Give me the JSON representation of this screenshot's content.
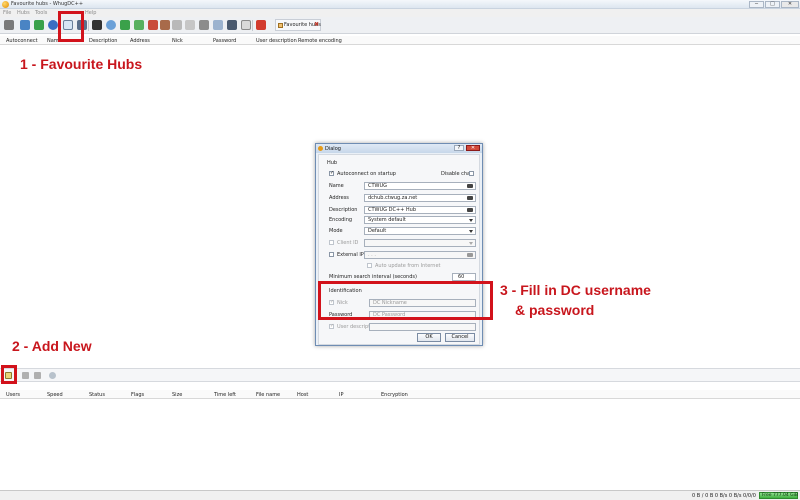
{
  "window": {
    "title": "Favourite hubs - WhugDC++",
    "minimize_label": "─",
    "maximize_label": "□",
    "close_label": "✕"
  },
  "menu": [
    "File",
    "Hubs",
    "Tools",
    "",
    "Help"
  ],
  "toolbar": {
    "active_tab": "Favourite hubs",
    "tab_close": "✖"
  },
  "favorite_hubs": {
    "columns": [
      "Autoconnect",
      "Name",
      "Description",
      "Address",
      "Nick",
      "Password",
      "User description",
      "Remote encoding"
    ]
  },
  "annotations": {
    "favourite_hubs": "1 - Favourite Hubs",
    "add_new": "2 - Add New",
    "fill_in_line1": "3 - Fill in DC username",
    "fill_in_line2": "& password"
  },
  "dialog": {
    "title": "Dialog",
    "help": "?",
    "close": "✕",
    "section_hub": "Hub",
    "autoconnect_label": "Autoconnect on startup",
    "autoconnect_checked": true,
    "disable_chat_label": "Disable chat",
    "name_label": "Name",
    "name_value": "CTWUG",
    "address_label": "Address",
    "address_value": "dchub.ctwug.za.net",
    "description_label": "Description",
    "description_value": "CTWUG DC++ Hub",
    "encoding_label": "Encoding",
    "encoding_value": "System default",
    "mode_label": "Mode",
    "mode_value": "Default",
    "client_id_label": "Client ID",
    "external_ip_label": "External IP",
    "external_ip_value": ". . .",
    "auto_update_label": "Auto update from Internet",
    "min_search_label": "Minimum search interval (seconds)",
    "min_search_value": "60",
    "identification_label": "Identification",
    "nick_label": "Nick",
    "nick_placeholder": "DC Nickname",
    "password_label": "Password",
    "password_placeholder": "DC Password",
    "user_description_label": "User description",
    "ok": "OK",
    "cancel": "Cancel"
  },
  "downloads": {
    "columns": [
      "Users",
      "Speed",
      "Status",
      "Flags",
      "Size",
      "Time left",
      "File name",
      "Host",
      "IP",
      "Encryption"
    ]
  },
  "statusbar": {
    "counts": "0 B / 0 B   0 B/s   0 B/s   0/0/0",
    "free": "Free 777.04 GiB"
  },
  "colors": {
    "annotation_red": "#d2121b",
    "free_space_green": "#3fae3f"
  }
}
